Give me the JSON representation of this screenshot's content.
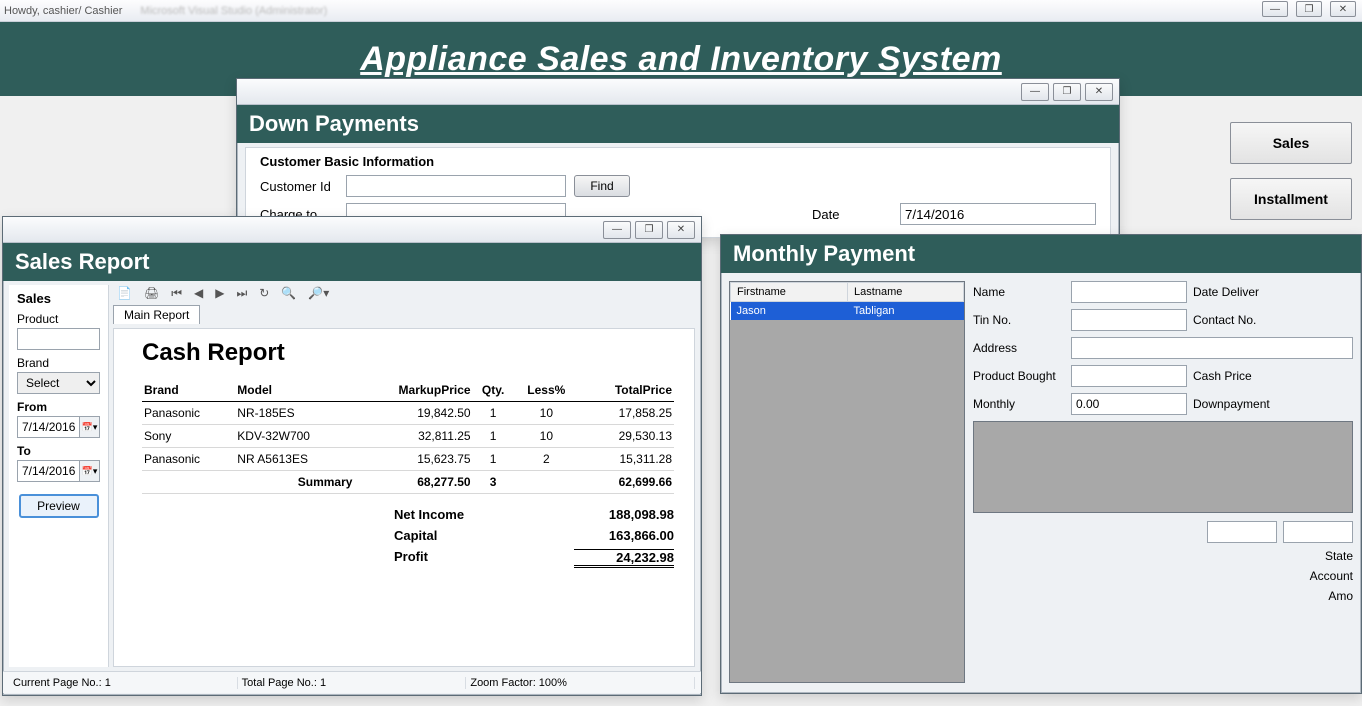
{
  "outer": {
    "title": "Howdy, cashier/ Cashier",
    "faded_text": "Microsoft Visual Studio (Administrator)",
    "btn_min": "—",
    "btn_max": "❐",
    "btn_close": "✕"
  },
  "app_header": "Appliance Sales and Inventory System",
  "right_buttons": {
    "sales": "Sales",
    "installment": "Installment"
  },
  "downpay": {
    "win_min": "—",
    "win_max": "❐",
    "win_close": "✕",
    "title": "Down Payments",
    "group": "Customer Basic Information",
    "customer_id_label": "Customer Id",
    "customer_id_value": "",
    "find": "Find",
    "charge_to_label": "Charge to",
    "charge_to_value": "",
    "date_label": "Date",
    "date_value": "7/14/2016"
  },
  "salesrep": {
    "win_min": "—",
    "win_max": "❐",
    "win_close": "✕",
    "title": "Sales Report",
    "side": {
      "heading": "Sales",
      "product_label": "Product",
      "product_value": "",
      "brand_label": "Brand",
      "brand_value": "Select",
      "from_label": "From",
      "from_value": "7/14/2016",
      "to_label": "To",
      "to_value": "7/14/2016",
      "preview": "Preview"
    },
    "toolbar_icons": [
      "📄",
      "🖨",
      "⏮",
      "◀",
      "▶",
      "⏭",
      "↻",
      "🔍",
      "🔎▾"
    ],
    "tab": "Main Report",
    "report": {
      "title": "Cash Report",
      "headers": [
        "Brand",
        "Model",
        "MarkupPrice",
        "Qty.",
        "Less%",
        "TotalPrice"
      ],
      "rows": [
        {
          "brand": "Panasonic",
          "model": "NR-185ES",
          "markup": "19,842.50",
          "qty": "1",
          "less": "10",
          "total": "17,858.25"
        },
        {
          "brand": "Sony",
          "model": "KDV-32W700",
          "markup": "32,811.25",
          "qty": "1",
          "less": "10",
          "total": "29,530.13"
        },
        {
          "brand": "Panasonic",
          "model": "NR A5613ES",
          "markup": "15,623.75",
          "qty": "1",
          "less": "2",
          "total": "15,311.28"
        }
      ],
      "summary_label": "Summary",
      "summary": {
        "markup": "68,277.50",
        "qty": "3",
        "total": "62,699.66"
      },
      "net_income_label": "Net Income",
      "net_income": "188,098.98",
      "capital_label": "Capital",
      "capital": "163,866.00",
      "profit_label": "Profit",
      "profit": "24,232.98"
    },
    "status": {
      "current": "Current Page No.: 1",
      "total": "Total Page No.: 1",
      "zoom": "Zoom Factor: 100%"
    }
  },
  "monthpay": {
    "title": "Monthly Payment",
    "cols": [
      "Firstname",
      "Lastname"
    ],
    "row": {
      "first": "Jason",
      "last": "Tabligan"
    },
    "labels": {
      "name": "Name",
      "date_deliver": "Date Deliver",
      "tin": "Tin No.",
      "contact": "Contact No.",
      "address": "Address",
      "product": "Product Bought",
      "cash": "Cash Price",
      "monthly": "Monthly",
      "down": "Downpayment",
      "state": "State",
      "account": "Account",
      "amo": "Amo"
    },
    "monthly_value": "0.00"
  }
}
